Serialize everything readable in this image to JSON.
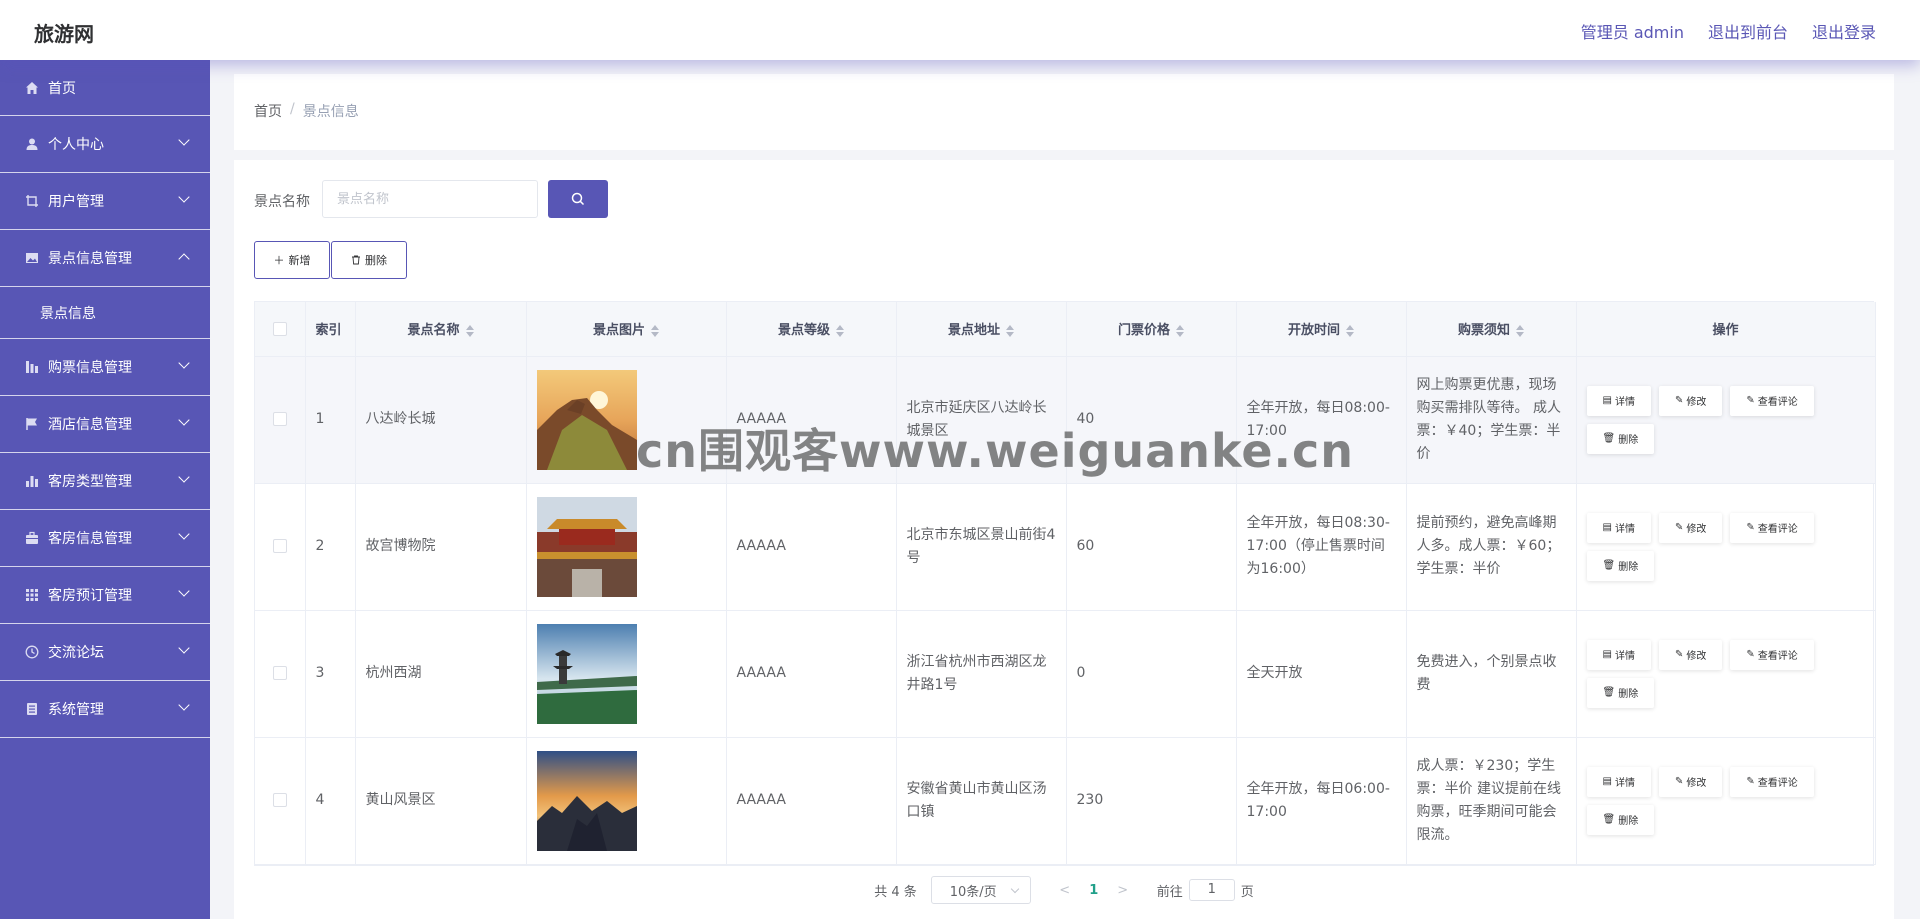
{
  "header": {
    "brand": "旅游网",
    "admin_label": "管理员 admin",
    "back_label": "退出到前台",
    "logout_label": "退出登录"
  },
  "sidebar": {
    "items": [
      {
        "label": "首页",
        "icon": "home-icon",
        "expandable": false
      },
      {
        "label": "个人中心",
        "icon": "user-icon",
        "expandable": true
      },
      {
        "label": "用户管理",
        "icon": "crop-icon",
        "expandable": true
      },
      {
        "label": "景点信息管理",
        "icon": "picture-icon",
        "expandable": true,
        "expanded": true,
        "children": [
          "景点信息"
        ]
      },
      {
        "label": "购票信息管理",
        "icon": "chart-icon",
        "expandable": true
      },
      {
        "label": "酒店信息管理",
        "icon": "flag-icon",
        "expandable": true
      },
      {
        "label": "客房类型管理",
        "icon": "histogram-icon",
        "expandable": true
      },
      {
        "label": "客房信息管理",
        "icon": "suitcase-icon",
        "expandable": true
      },
      {
        "label": "客房预订管理",
        "icon": "grid-icon",
        "expandable": true
      },
      {
        "label": "交流论坛",
        "icon": "clock-icon",
        "expandable": true
      },
      {
        "label": "系统管理",
        "icon": "notebook-icon",
        "expandable": true
      }
    ]
  },
  "breadcrumb": {
    "home": "首页",
    "separator": "/",
    "current": "景点信息"
  },
  "search": {
    "label": "景点名称",
    "placeholder": "景点名称",
    "value": ""
  },
  "toolbar": {
    "add_label": "新增",
    "delete_label": "删除"
  },
  "table": {
    "headers": [
      "索引",
      "景点名称",
      "景点图片",
      "景点等级",
      "景点地址",
      "门票价格",
      "开放时间",
      "购票须知",
      "操作"
    ],
    "rows": [
      {
        "index": "1",
        "name": "八达岭长城",
        "image": "great-wall-photo",
        "level": "AAAAA",
        "address": "北京市延庆区八达岭长城景区",
        "price": "40",
        "hours": "全年开放，每日08:00-17:00",
        "notice": "网上购票更优惠，现场购买需排队等待。 成人票：￥40；学生票：半价"
      },
      {
        "index": "2",
        "name": "故宫博物院",
        "image": "forbidden-city-photo",
        "level": "AAAAA",
        "address": "北京市东城区景山前街4号",
        "price": "60",
        "hours": "全年开放，每日08:30-17:00（停止售票时间为16:00）",
        "notice": "提前预约，避免高峰期人多。成人票：￥60；学生票：半价"
      },
      {
        "index": "3",
        "name": "杭州西湖",
        "image": "west-lake-photo",
        "level": "AAAAA",
        "address": "浙江省杭州市西湖区龙井路1号",
        "price": "0",
        "hours": "全天开放",
        "notice": "免费进入，个别景点收费"
      },
      {
        "index": "4",
        "name": "黄山风景区",
        "image": "huangshan-photo",
        "level": "AAAAA",
        "address": "安徽省黄山市黄山区汤口镇",
        "price": "230",
        "hours": "全年开放，每日06:00-17:00",
        "notice": "成人票：￥230；学生票：半价 建议提前在线购票，旺季期间可能会限流。"
      }
    ],
    "row_actions": [
      "详情",
      "修改",
      "查看评论",
      "删除"
    ]
  },
  "pagination": {
    "total": "共 4 条",
    "page_size": "10条/页",
    "prev": "<",
    "current_page": "1",
    "next": ">",
    "goto_label": "前往",
    "goto_value": "1",
    "page_unit": "页"
  },
  "watermark": "cn围观客www.weiguanke.cn",
  "colors": {
    "accent": "#5856b5",
    "pager_active": "#21a08a"
  }
}
